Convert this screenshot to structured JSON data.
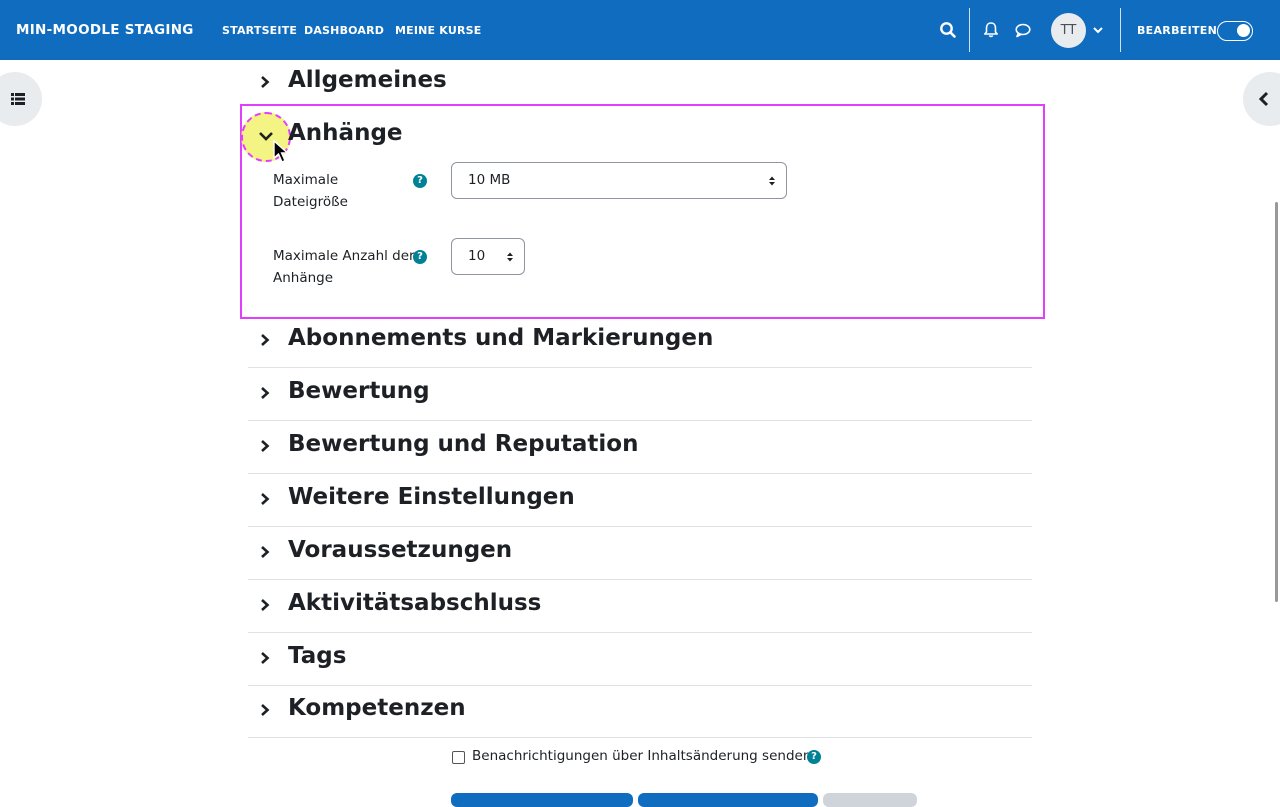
{
  "header": {
    "brand": "MIN-MOODLE STAGING",
    "nav": [
      "STARTSEITE",
      "DASHBOARD",
      "MEINE KURSE"
    ],
    "avatar_initials": "TT",
    "edit_label": "BEARBEITEN",
    "edit_mode_on": true,
    "brand_color": "#0f6cbf"
  },
  "sections": {
    "allgemeines": "Allgemeines",
    "anhaenge": "Anhänge",
    "abonnements": "Abonnements und Markierungen",
    "bewertung": "Bewertung",
    "reputation": "Bewertung und Reputation",
    "weitere": "Weitere Einstellungen",
    "voraussetzungen": "Voraussetzungen",
    "abschluss": "Aktivitätsabschluss",
    "tags": "Tags",
    "kompetenzen": "Kompetenzen"
  },
  "attachments": {
    "max_size_label_1": "Maximale",
    "max_size_label_2": "Dateigröße",
    "max_size_value": "10 MB",
    "max_count_label_1": "Maximale Anzahl der",
    "max_count_label_2": "Anhänge",
    "max_count_value": "10",
    "help_glyph": "?"
  },
  "notify": {
    "label": "Benachrichtigungen über Inhaltsänderung senden",
    "checked": false
  },
  "icons": [
    "search-icon",
    "bell-icon",
    "chat-icon",
    "chevron-down-icon",
    "list-icon",
    "chevron-left-icon",
    "chevron-right-icon",
    "select-arrows-icon",
    "help-icon"
  ],
  "colors": {
    "help": "#008196",
    "highlight": "#e040fb",
    "submit_button": "#0f6cbf",
    "cancel_button": "#ced4da"
  }
}
